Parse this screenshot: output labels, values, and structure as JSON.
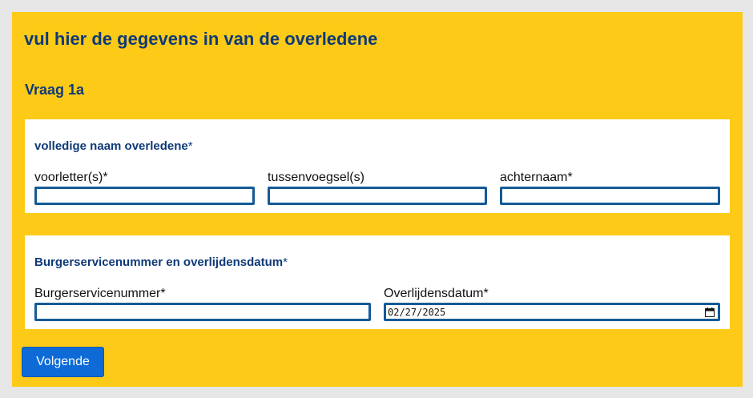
{
  "page": {
    "title": "vul hier de gegevens in van de overledene",
    "question_label": "Vraag 1a"
  },
  "name_section": {
    "heading": "volledige naam overledene",
    "required_mark": "*",
    "initials": {
      "label": "voorletter(s)*",
      "value": ""
    },
    "infix": {
      "label": "tussenvoegsel(s)",
      "value": ""
    },
    "surname": {
      "label": "achternaam*",
      "value": ""
    }
  },
  "bsn_section": {
    "heading": "Burgerservicenummer en overlijdensdatum",
    "required_mark": "*",
    "bsn": {
      "label": "Burgerservicenummer*",
      "value": ""
    },
    "date_of_death": {
      "label": "Overlijdensdatum*",
      "value": "02/27/2025",
      "icon": "calendar-icon"
    }
  },
  "actions": {
    "next_label": "Volgende"
  },
  "colors": {
    "panel_background": "#fdca17",
    "heading_text": "#0f3a78",
    "input_border": "#145a96",
    "button_background": "#0d6ad6"
  }
}
